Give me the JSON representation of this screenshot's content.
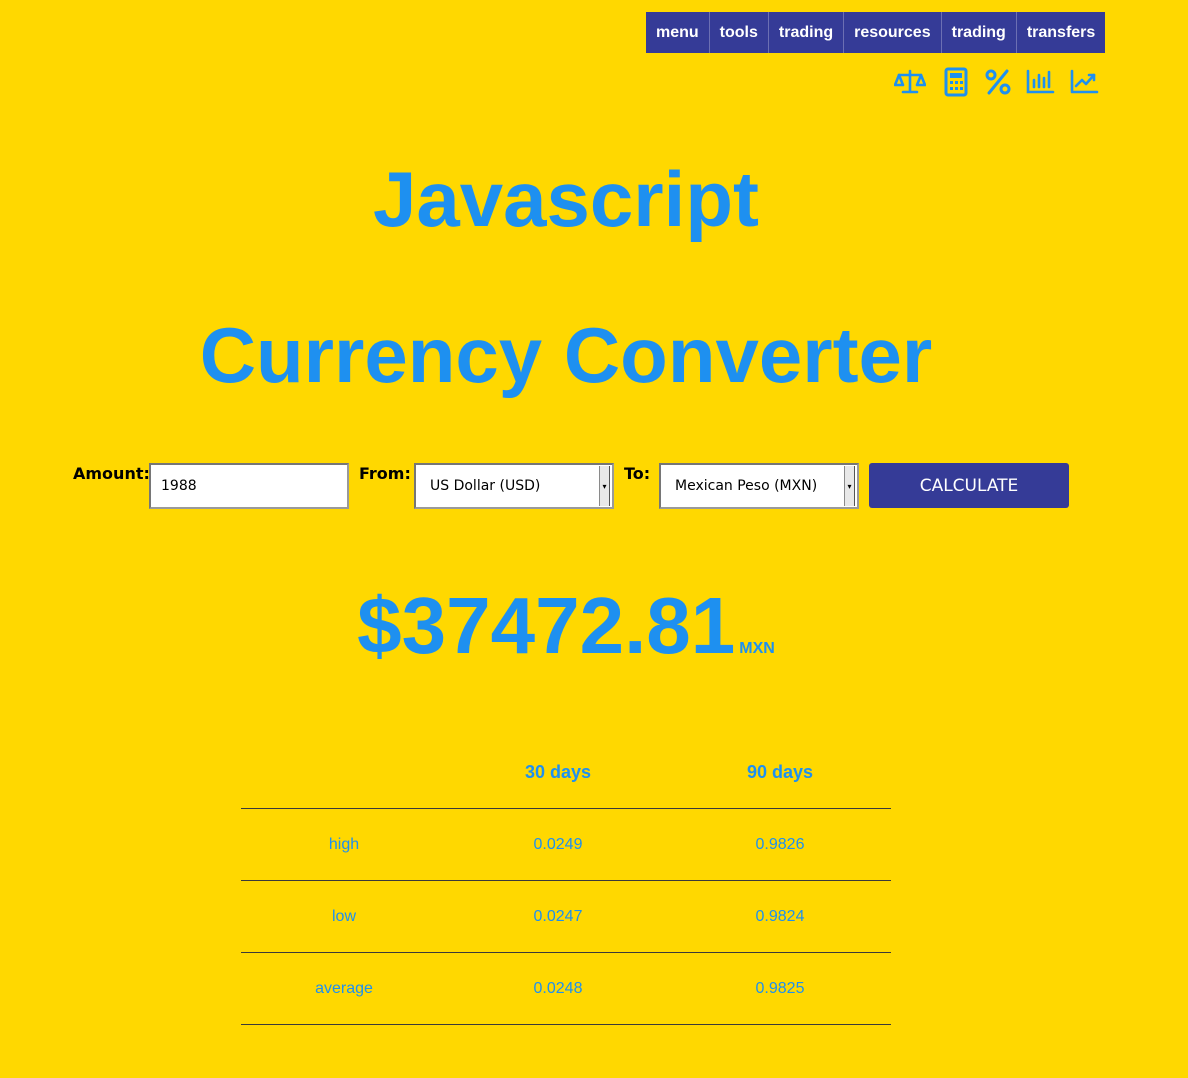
{
  "nav": {
    "items": [
      {
        "label": "menu"
      },
      {
        "label": "tools"
      },
      {
        "label": "trading"
      },
      {
        "label": "resources"
      },
      {
        "label": "trading"
      },
      {
        "label": "transfers"
      }
    ]
  },
  "icons": [
    "balance-scale-icon",
    "calculator-icon",
    "percent-icon",
    "bar-chart-icon",
    "line-chart-icon"
  ],
  "header": {
    "title_line1": "Javascript",
    "title_line2": "Currency Converter"
  },
  "form": {
    "amount_label": "Amount:",
    "amount_value": "1988",
    "from_label": "From:",
    "from_value": "US Dollar (USD)",
    "to_label": "To:",
    "to_value": "Mexican Peso (MXN)",
    "calculate_label": "CALCULATE"
  },
  "result": {
    "amount": "$37472.81",
    "currency": "MXN"
  },
  "stats": {
    "headers": [
      "",
      "30 days",
      "90 days"
    ],
    "rows": [
      {
        "label": "high",
        "d30": "0.0249",
        "d90": "0.9826"
      },
      {
        "label": "low",
        "d30": "0.0247",
        "d90": "0.9824"
      },
      {
        "label": "average",
        "d30": "0.0248",
        "d90": "0.9825"
      }
    ]
  },
  "colors": {
    "background": "#FFD800",
    "accent": "#1E90F0",
    "button": "#353B97"
  }
}
